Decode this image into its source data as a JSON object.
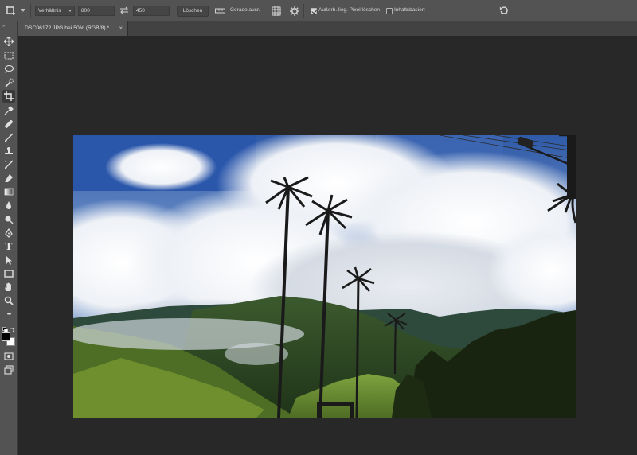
{
  "options_bar": {
    "ratio_select": "Verhältnis",
    "width_value": "800",
    "height_value": "450",
    "clear_button": "Löschen",
    "straighten_label": "Gerade ausr.",
    "delete_cropped_label": "Außerh. lieg. Pixel löschen",
    "delete_cropped_checked": true,
    "content_aware_label": "Inhaltsbasiert",
    "content_aware_checked": false
  },
  "document": {
    "tab_title": "DSC06172.JPG bei 50% (RGB/8) *",
    "close_glyph": "×"
  },
  "toolbar": {
    "grip": "»",
    "tools": [
      "move-tool",
      "rectangular-marquee-tool",
      "lasso-tool",
      "quick-selection-tool",
      "crop-tool",
      "eyedropper-tool",
      "healing-brush-tool",
      "brush-tool",
      "clone-stamp-tool",
      "history-brush-tool",
      "eraser-tool",
      "gradient-tool",
      "blur-tool",
      "dodge-tool",
      "pen-tool",
      "type-tool",
      "path-selection-tool",
      "rectangle-tool",
      "hand-tool",
      "zoom-tool",
      "more-tools"
    ],
    "active_tool": "crop-tool",
    "foreground_color": "#000000",
    "background_color": "#ffffff",
    "type_tool_glyph": "T",
    "more_tools_glyph": "•••"
  },
  "colors": {
    "panel": "#535353",
    "canvas_bg": "#282828",
    "accent_check": "#d8d8d8"
  }
}
